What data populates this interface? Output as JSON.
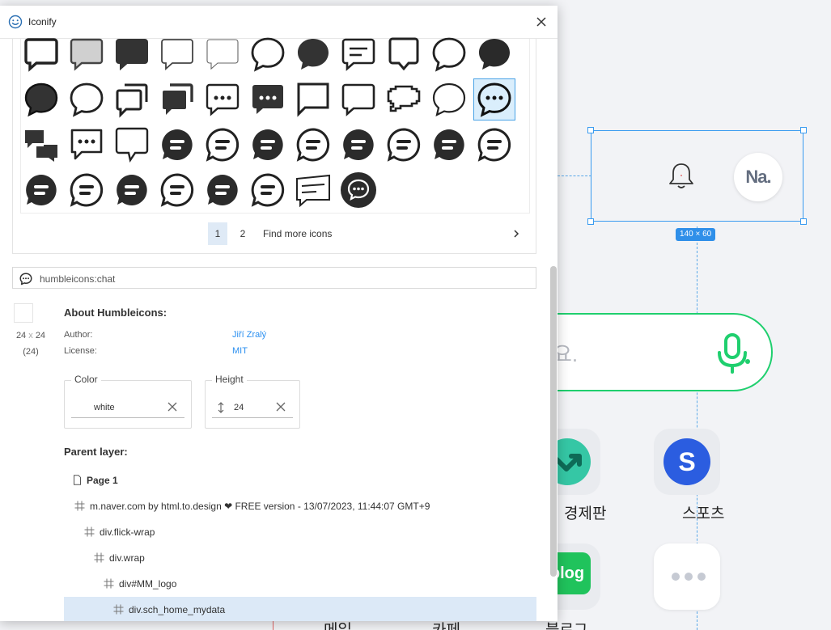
{
  "window": {
    "title": "Iconify"
  },
  "icon_grid": {
    "rows": [
      [
        "square-chat-outline-bold",
        "square-chat-filled-gray",
        "square-chat-filled",
        "square-chat-outline",
        "square-chat-thin",
        "round-chat-outline",
        "round-chat-filled",
        "chat-lines-outline",
        "chat-square-tail",
        "round-chat-thin",
        "round-chat-filled-2"
      ],
      [
        "round-chat-filled-outline",
        "round-chat-outline",
        "chats-outline",
        "chats-filled",
        "chat-dots-outline",
        "chat-dots-filled",
        "chat-corner-outline",
        "chat-square-outline",
        "chat-pixel-outline",
        "round-chat-outline-2",
        "chat-dots-round-selected"
      ],
      [
        "chats-filled-2",
        "chat-dots-square",
        "chat-tail-outline",
        "chat-lines-round-filled",
        "chat-lines-round-outline",
        "chat-lines-round-filled",
        "chat-lines-round-outline",
        "chat-lines-round-filled",
        "chat-lines-round-outline",
        "chat-lines-round-filled",
        "chat-lines-round-outline"
      ],
      [
        "chat-lines-round-filled",
        "chat-lines-round-outline",
        "chat-lines-round-filled",
        "chat-lines-round-outline",
        "chat-lines-round-filled",
        "chat-lines-round-outline",
        "chat-text-outline",
        "chat-dots-circle-filled"
      ]
    ],
    "selected": "chat-dots-round-selected"
  },
  "pagination": {
    "page1": "1",
    "page2": "2",
    "more": "Find more icons",
    "next_icon": "chevron-right-icon"
  },
  "icon_name": "humbleicons:chat",
  "icon_info": {
    "width": "24",
    "x": "x",
    "height": "24",
    "size_note": "(24)"
  },
  "about": {
    "title": "About Humbleicons:",
    "author_label": "Author:",
    "author": "Jiří Zralý",
    "license_label": "License:",
    "license": "MIT"
  },
  "color_field": {
    "label": "Color",
    "value": "white"
  },
  "height_field": {
    "label": "Height",
    "value": "24"
  },
  "parent": {
    "title": "Parent layer:",
    "items": [
      "Page 1",
      "m.naver.com by html.to.design ❤ FREE version - 13/07/2023, 11:44:07 GMT+9",
      "div.flick-wrap",
      "div.wrap",
      "div#MM_logo",
      "div.sch_home_mydata"
    ]
  },
  "canvas": {
    "selection_size": "140 × 60",
    "avatar_text": "Na.",
    "search_hint": "요.",
    "apps": [
      "경제판",
      "스포츠",
      "blog",
      "메일",
      "카페",
      "블로그"
    ],
    "colors": {
      "green": "#1fcf6e",
      "blue": "#2f8fe9",
      "sports": "#2b5de0",
      "finance": "#35c7a5",
      "blog": "#20c35c"
    }
  }
}
